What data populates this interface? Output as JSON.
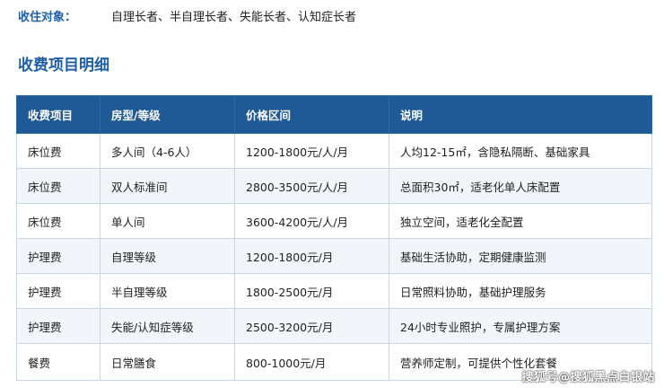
{
  "intro": {
    "label": "收住对象：",
    "value": "自理长者、半自理长者、失能长者、认知症长者"
  },
  "section_title": "收费项目明细",
  "table": {
    "headers": [
      "收费项目",
      "房型/等级",
      "价格区间",
      "说明"
    ],
    "rows": [
      [
        "床位费",
        "多人间（4-6人）",
        "1200-1800元/人/月",
        "人均12-15㎡，含隐私隔断、基础家具"
      ],
      [
        "床位费",
        "双人标准间",
        "2800-3500元/人/月",
        "总面积30㎡，适老化单人床配置"
      ],
      [
        "床位费",
        "单人间",
        "3600-4200元/人/月",
        "独立空间，适老化全配置"
      ],
      [
        "护理费",
        "自理等级",
        "1200-1800元/月",
        "基础生活协助，定期健康监测"
      ],
      [
        "护理费",
        "半自理等级",
        "1800-2500元/月",
        "日常照料协助，基础护理服务"
      ],
      [
        "护理费",
        "失能/认知症等级",
        "2500-3200元/月",
        "24小时专业照护，专属护理方案"
      ],
      [
        "餐费",
        "日常膳食",
        "800-1000元/月",
        "营养师定制，可提供个性化套餐"
      ]
    ]
  },
  "watermark": "搜狐号@搜狐黑点白银站",
  "colors": {
    "accent": "#1f5fa6",
    "header_bg": "#1f5a96",
    "alt_row_bg": "#f2f6fa"
  }
}
